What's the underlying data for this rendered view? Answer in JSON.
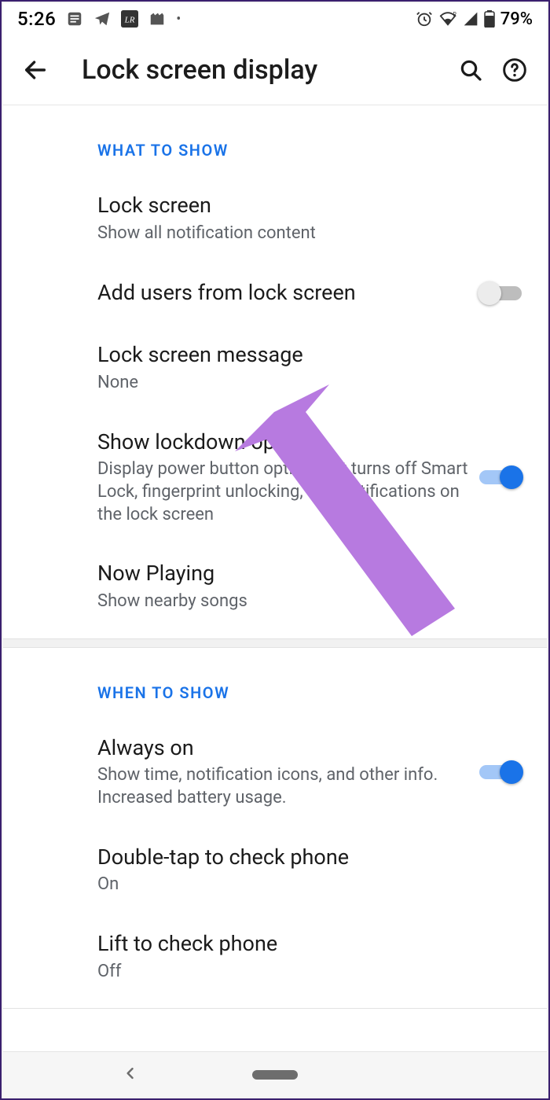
{
  "status": {
    "time": "5:26",
    "battery": "79%"
  },
  "appbar": {
    "title": "Lock screen display"
  },
  "sections": {
    "what": {
      "header": "WHAT TO SHOW",
      "lock_screen": {
        "label": "Lock screen",
        "sub": "Show all notification content"
      },
      "add_users": {
        "label": "Add users from lock screen",
        "on": false
      },
      "message": {
        "label": "Lock screen message",
        "sub": "None"
      },
      "lockdown": {
        "label": "Show lockdown option",
        "sub": "Display power button option that turns off Smart Lock, fingerprint unlocking, and notifications on the lock screen",
        "on": true
      },
      "now_playing": {
        "label": "Now Playing",
        "sub": "Show nearby songs"
      }
    },
    "when": {
      "header": "WHEN TO SHOW",
      "always_on": {
        "label": "Always on",
        "sub": "Show time, notification icons, and other info. Increased battery usage.",
        "on": true
      },
      "double_tap": {
        "label": "Double-tap to check phone",
        "sub": "On"
      },
      "lift": {
        "label": "Lift to check phone",
        "sub": "Off"
      }
    }
  }
}
